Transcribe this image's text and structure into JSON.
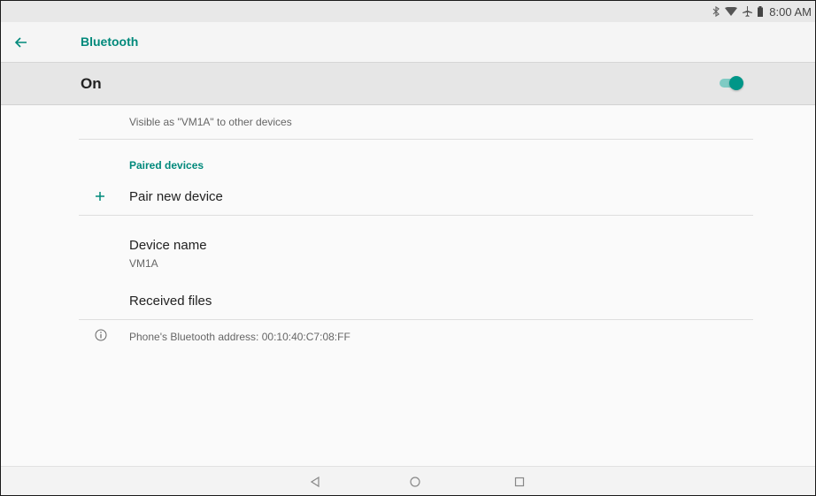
{
  "status_bar": {
    "time": "8:00 AM",
    "icons": [
      "bluetooth-icon",
      "wifi-icon",
      "airplane-icon",
      "battery-icon"
    ]
  },
  "app_bar": {
    "title": "Bluetooth",
    "back_icon": "back-arrow-icon"
  },
  "master_switch": {
    "label": "On",
    "state": true
  },
  "visibility_text": "Visible as \"VM1A\" to other devices",
  "paired_section": {
    "header": "Paired devices",
    "pair_new_label": "Pair new device",
    "pair_new_icon": "plus-icon"
  },
  "device_name": {
    "label": "Device name",
    "value": "VM1A"
  },
  "received_files": {
    "label": "Received files"
  },
  "address_info": {
    "text": "Phone's Bluetooth address: 00:10:40:C7:08:FF",
    "icon": "info-icon"
  },
  "nav_bar": {
    "buttons": [
      "back-nav-icon",
      "home-nav-icon",
      "recents-nav-icon"
    ]
  },
  "colors": {
    "accent": "#00897b",
    "toggle_thumb": "#009688",
    "toggle_track": "#80cbc4"
  }
}
